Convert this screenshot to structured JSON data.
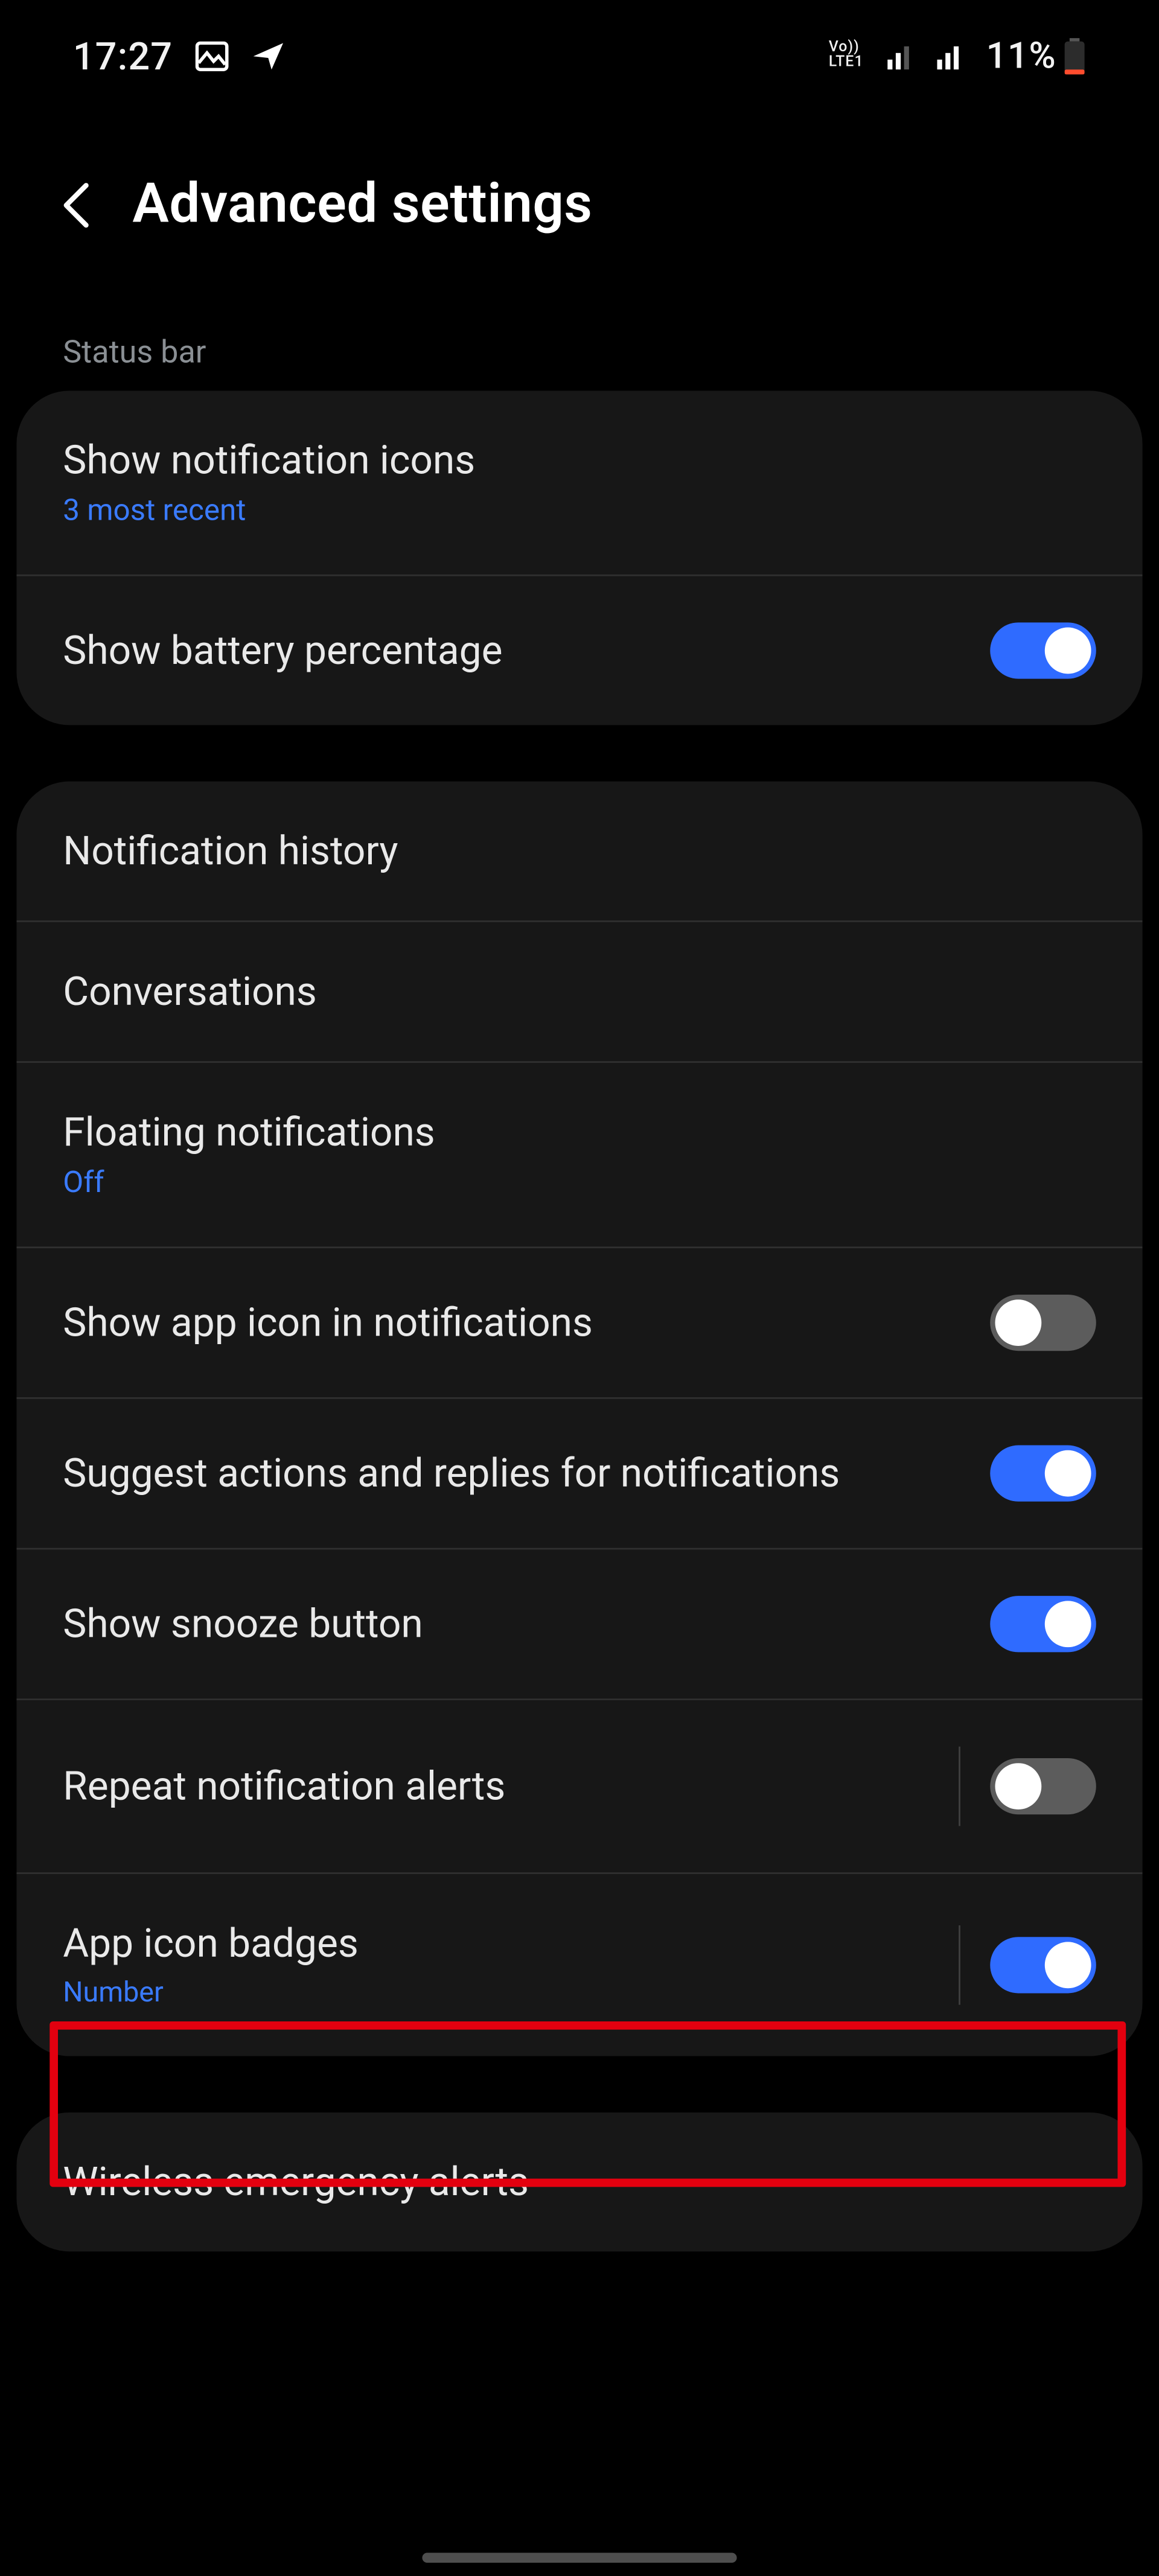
{
  "status": {
    "time": "17:27",
    "battery_pct": "11%"
  },
  "header": {
    "title": "Advanced settings"
  },
  "sections": {
    "status_bar_label": "Status bar",
    "show_notification_icons": "Show notification icons",
    "show_notification_icons_value": "3 most recent",
    "show_battery_percentage": "Show battery percentage",
    "notification_history": "Notification history",
    "conversations": "Conversations",
    "floating_notifications": "Floating notifications",
    "floating_notifications_value": "Off",
    "show_app_icon_in_notifications": "Show app icon in notifications",
    "suggest_actions_and_replies": "Suggest actions and replies for notifications",
    "show_snooze_button": "Show snooze button",
    "repeat_notification_alerts": "Repeat notification alerts",
    "app_icon_badges": "App icon badges",
    "app_icon_badges_value": "Number",
    "wireless_emergency_alerts": "Wireless emergency alerts"
  },
  "toggles": {
    "show_battery_percentage": true,
    "show_app_icon_in_notifications": false,
    "suggest_actions_and_replies": true,
    "show_snooze_button": true,
    "repeat_notification_alerts": false,
    "app_icon_badges": true
  },
  "colors": {
    "accent": "#2f6bff",
    "link": "#3a7bff",
    "card_bg": "#171717",
    "highlight": "#e3000f"
  }
}
